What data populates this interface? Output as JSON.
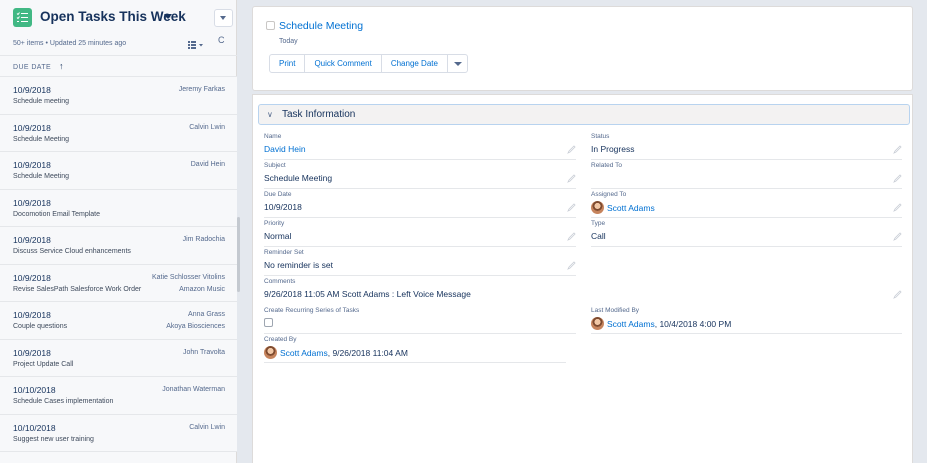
{
  "list": {
    "title": "Open Tasks This Week",
    "meta": "50+ items • Updated 25 minutes ago",
    "sort_label": "DUE DATE",
    "sort_arrow": "↑",
    "refresh_glyph": "C",
    "icons": {
      "list_icon": "task-list-icon",
      "display": "list-display-icon",
      "refresh": "refresh-icon"
    },
    "rows": [
      {
        "date": "10/9/2018",
        "subject": "Schedule meeting",
        "owner": "Jeremy Farkas",
        "account": ""
      },
      {
        "date": "10/9/2018",
        "subject": "Schedule Meeting",
        "owner": "Calvin Lwin",
        "account": ""
      },
      {
        "date": "10/9/2018",
        "subject": "Schedule Meeting",
        "owner": "David Hein",
        "account": ""
      },
      {
        "date": "10/9/2018",
        "subject": "Docomotion Email Template",
        "owner": "",
        "account": ""
      },
      {
        "date": "10/9/2018",
        "subject": "Discuss Service Cloud enhancements",
        "owner": "Jim Radochia",
        "account": ""
      },
      {
        "date": "10/9/2018",
        "subject": "Revise SalesPath Salesforce Work Order",
        "owner": "Katie Schlosser Vitolins",
        "account": "Amazon Music"
      },
      {
        "date": "10/9/2018",
        "subject": "Couple questions",
        "owner": "Anna Grass",
        "account": "Akoya Biosciences"
      },
      {
        "date": "10/9/2018",
        "subject": "Project Update Call",
        "owner": "John Travolta",
        "account": ""
      },
      {
        "date": "10/10/2018",
        "subject": "Schedule Cases implementation",
        "owner": "Jonathan Waterman",
        "account": ""
      },
      {
        "date": "10/10/2018",
        "subject": "Suggest new user training",
        "owner": "Calvin Lwin",
        "account": ""
      }
    ]
  },
  "detail": {
    "title": "Schedule Meeting",
    "date": "Today",
    "actions": [
      "Print",
      "Quick Comment",
      "Change Date"
    ],
    "section_title": "Task Information",
    "section_chevron": "∨",
    "fields": {
      "name": {
        "label": "Name",
        "value": "David Hein"
      },
      "status": {
        "label": "Status",
        "value": "In Progress"
      },
      "subject": {
        "label": "Subject",
        "value": "Schedule Meeting"
      },
      "related_to": {
        "label": "Related To",
        "value": ""
      },
      "due_date": {
        "label": "Due Date",
        "value": "10/9/2018"
      },
      "assigned_to": {
        "label": "Assigned To",
        "value": "Scott Adams"
      },
      "priority": {
        "label": "Priority",
        "value": "Normal"
      },
      "type": {
        "label": "Type",
        "value": "Call"
      },
      "reminder": {
        "label": "Reminder Set",
        "value": "No reminder is set"
      },
      "comments": {
        "label": "Comments",
        "value": "9/26/2018 11:05 AM Scott Adams : Left Voice Message"
      },
      "recurring": {
        "label": "Create Recurring Series of Tasks",
        "value": ""
      },
      "last_modified": {
        "label": "Last Modified By",
        "user": "Scott Adams",
        "date": ", 10/4/2018 4:00 PM"
      },
      "created_by": {
        "label": "Created By",
        "user": "Scott Adams",
        "date": ", 9/26/2018 11:04 AM"
      }
    }
  },
  "colors": {
    "brand_blue": "#0070d2",
    "text_dark": "#16325c",
    "text_muted": "#54698d",
    "task_icon_green": "#41b884",
    "section_border": "#b8d3ef"
  }
}
